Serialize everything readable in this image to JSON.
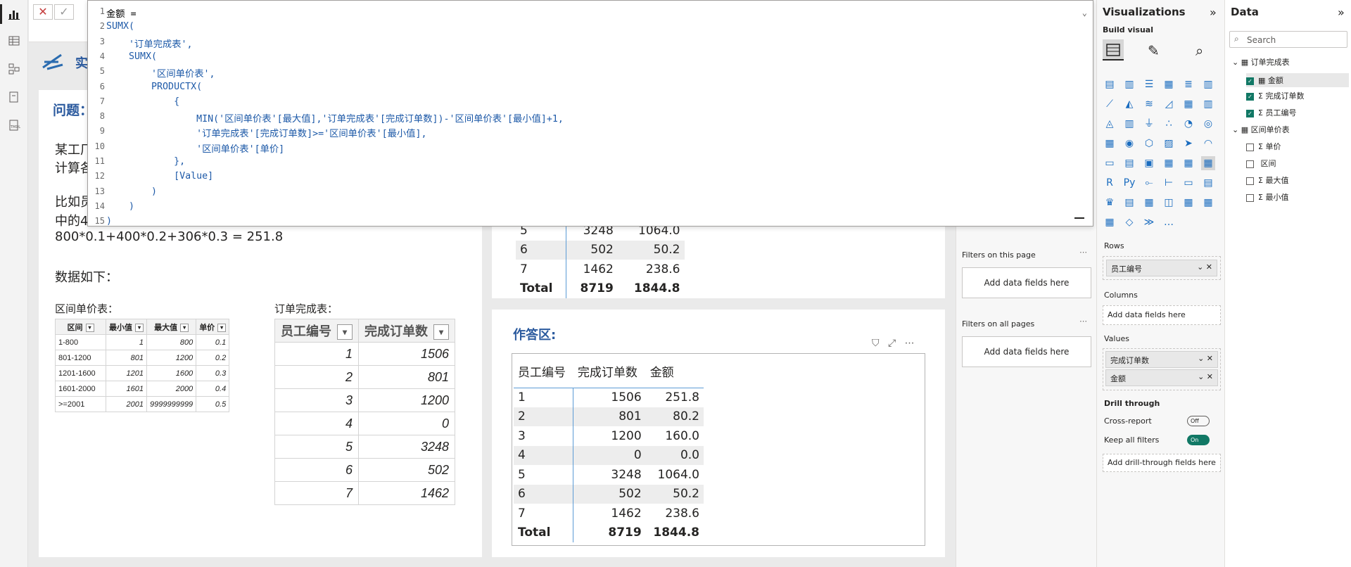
{
  "formula": {
    "lines": [
      "金额 =",
      "SUMX(",
      "    '订单完成表',",
      "    SUMX(",
      "        '区间单价表',",
      "        PRODUCTX(",
      "            {",
      "                MIN('区间单价表'[最大值],'订单完成表'[完成订单数])-'区间单价表'[最小值]+1,",
      "                '订单完成表'[完成订单数]>='区间单价表'[最小值],",
      "                '区间单价表'[单价]",
      "            },",
      "            [Value]",
      "        )",
      "    )",
      ")"
    ]
  },
  "problem": {
    "header": "问题：",
    "line1": "某工厂",
    "line2": "计算各",
    "line3": "比如员",
    "line4": "中的4",
    "line5": "800*0.1+400*0.2+306*0.3 = 251.8",
    "data_label": "数据如下："
  },
  "range_table": {
    "title": "区间单价表：",
    "headers": [
      "区间",
      "最小值",
      "最大值",
      "单价"
    ],
    "rows": [
      [
        "1-800",
        "1",
        "800",
        "0.1"
      ],
      [
        "801-1200",
        "801",
        "1200",
        "0.2"
      ],
      [
        "1201-1600",
        "1201",
        "1600",
        "0.3"
      ],
      [
        "1601-2000",
        "1601",
        "2000",
        "0.4"
      ],
      [
        ">=2001",
        "2001",
        "9999999999",
        "0.5"
      ]
    ]
  },
  "order_table": {
    "title": "订单完成表：",
    "headers": [
      "员工编号",
      "完成订单数"
    ],
    "rows": [
      [
        "1",
        "1506"
      ],
      [
        "2",
        "801"
      ],
      [
        "3",
        "1200"
      ],
      [
        "4",
        "0"
      ],
      [
        "5",
        "3248"
      ],
      [
        "6",
        "502"
      ],
      [
        "7",
        "1462"
      ]
    ]
  },
  "top_matrix": {
    "rows": [
      [
        "5",
        "3248",
        "1064.0"
      ],
      [
        "6",
        "502",
        "50.2"
      ],
      [
        "7",
        "1462",
        "238.6"
      ]
    ],
    "total": [
      "Total",
      "8719",
      "1844.8"
    ]
  },
  "answer": {
    "title": "作答区:",
    "headers": [
      "员工编号",
      "完成订单数",
      "金额"
    ],
    "rows": [
      [
        "1",
        "1506",
        "251.8"
      ],
      [
        "2",
        "801",
        "80.2"
      ],
      [
        "3",
        "1200",
        "160.0"
      ],
      [
        "4",
        "0",
        "0.0"
      ],
      [
        "5",
        "3248",
        "1064.0"
      ],
      [
        "6",
        "502",
        "50.2"
      ],
      [
        "7",
        "1462",
        "238.6"
      ]
    ],
    "total": [
      "Total",
      "8719",
      "1844.8"
    ]
  },
  "filters": {
    "on_page": "Filters on this page",
    "on_all": "Filters on all pages",
    "add": "Add data fields here"
  },
  "viz": {
    "title": "Visualizations",
    "build": "Build visual",
    "rows_label": "Rows",
    "rows_field": "员工编号",
    "columns_label": "Columns",
    "columns_add": "Add data fields here",
    "values_label": "Values",
    "values_fields": [
      "完成订单数",
      "金额"
    ],
    "drill": "Drill through",
    "cross": "Cross-report",
    "cross_state": "Off",
    "keep": "Keep all filters",
    "keep_state": "On",
    "drill_add": "Add drill-through fields here"
  },
  "data": {
    "title": "Data",
    "search": "Search",
    "table1": "订单完成表",
    "t1_fields": [
      "金额",
      "完成订单数",
      "员工编号"
    ],
    "table2": "区间单价表",
    "t2_fields": [
      "单价",
      "区间",
      "最大值",
      "最小值"
    ]
  },
  "colors": {
    "accent": "#117865",
    "header_blue": "#2b5a9e"
  }
}
